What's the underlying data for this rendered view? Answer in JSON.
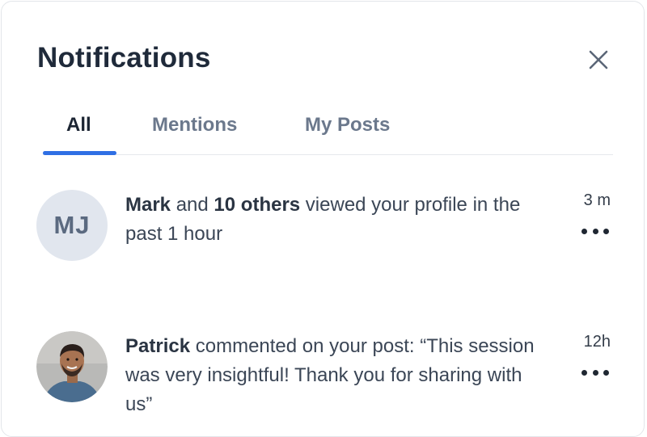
{
  "header": {
    "title": "Notifications",
    "close_icon": "close-icon"
  },
  "tabs": [
    {
      "label": "All",
      "active": true
    },
    {
      "label": "Mentions",
      "active": false
    },
    {
      "label": "My Posts",
      "active": false
    }
  ],
  "colors": {
    "accent": "#2f6fe4",
    "title": "#1f2a3a",
    "tab_inactive": "#6b788c",
    "avatar_bg": "#e1e6ee"
  },
  "notifications": [
    {
      "avatar_initials": "MJ",
      "actor": "Mark",
      "connector": " and ",
      "others": "10 others",
      "message": " viewed your profile in the past 1 hour",
      "time": "3 m",
      "more_icon": "more-dots-icon"
    },
    {
      "avatar_icon": "user-photo-avatar",
      "actor": "Patrick",
      "message": " commented on your post: “This session was very insightful! Thank you for sharing with us”",
      "time": "12h",
      "more_icon": "more-dots-icon"
    }
  ]
}
